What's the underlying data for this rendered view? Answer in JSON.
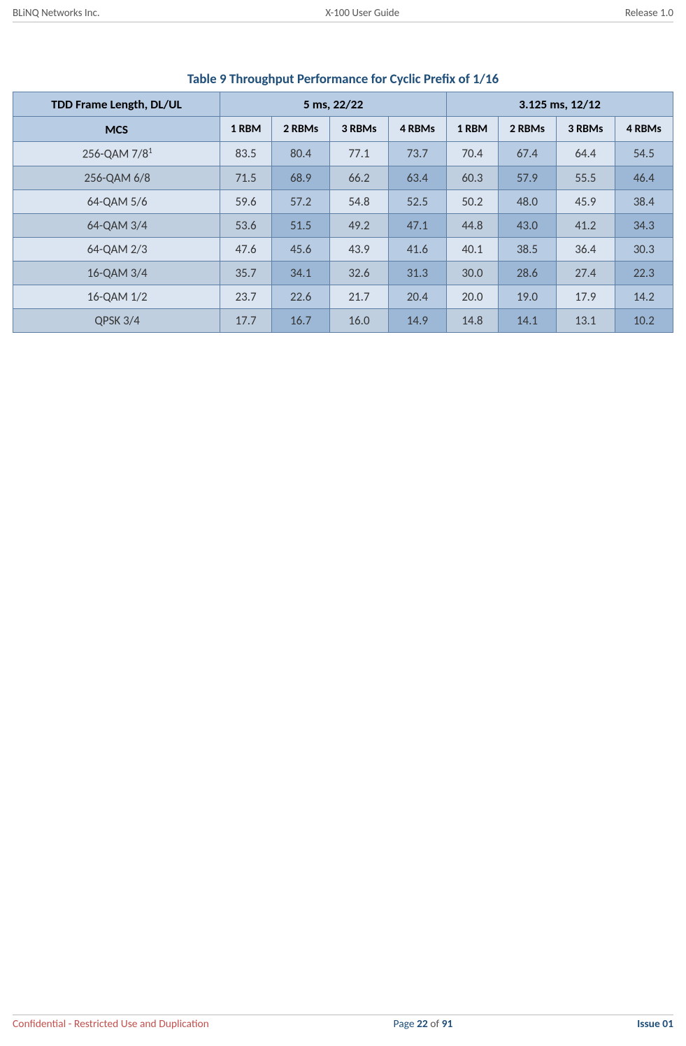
{
  "header": {
    "left": "BLiNQ Networks Inc.",
    "center": "X-100 User Guide",
    "right": "Release 1.0"
  },
  "table_title": "Table 9  Throughput Performance for Cyclic Prefix of 1/16",
  "columns": {
    "frame_label": "TDD Frame Length, DL/UL",
    "group1": "5 ms, 22/22",
    "group2": "3.125 ms, 12/12",
    "mcs": "MCS",
    "c1": "1 RBM",
    "c2": "2 RBMs",
    "c3": "3 RBMs",
    "c4": "4 RBMs",
    "c5": "1 RBM",
    "c6": "2 RBMs",
    "c7": "3 RBMs",
    "c8": "4 RBMs"
  },
  "rows": [
    {
      "label": "256-QAM 7/8",
      "sup": "1",
      "v": [
        "83.5",
        "80.4",
        "77.1",
        "73.7",
        "70.4",
        "67.4",
        "64.4",
        "54.5"
      ]
    },
    {
      "label": "256-QAM 6/8",
      "v": [
        "71.5",
        "68.9",
        "66.2",
        "63.4",
        "60.3",
        "57.9",
        "55.5",
        "46.4"
      ]
    },
    {
      "label": "64-QAM 5/6",
      "v": [
        "59.6",
        "57.2",
        "54.8",
        "52.5",
        "50.2",
        "48.0",
        "45.9",
        "38.4"
      ]
    },
    {
      "label": "64-QAM 3/4",
      "v": [
        "53.6",
        "51.5",
        "49.2",
        "47.1",
        "44.8",
        "43.0",
        "41.2",
        "34.3"
      ]
    },
    {
      "label": "64-QAM 2/3",
      "v": [
        "47.6",
        "45.6",
        "43.9",
        "41.6",
        "40.1",
        "38.5",
        "36.4",
        "30.3"
      ]
    },
    {
      "label": "16-QAM 3/4",
      "v": [
        "35.7",
        "34.1",
        "32.6",
        "31.3",
        "30.0",
        "28.6",
        "27.4",
        "22.3"
      ]
    },
    {
      "label": "16-QAM 1/2",
      "v": [
        "23.7",
        "22.6",
        "21.7",
        "20.4",
        "20.0",
        "19.0",
        "17.9",
        "14.2"
      ]
    },
    {
      "label": "QPSK 3/4",
      "v": [
        "17.7",
        "16.7",
        "16.0",
        "14.9",
        "14.8",
        "14.1",
        "13.1",
        "10.2"
      ]
    }
  ],
  "footer": {
    "left": "Confidential - Restricted Use and Duplication",
    "page_prefix": "Page ",
    "page_num": "22",
    "page_of": " of ",
    "page_total": "91",
    "right": "Issue 01"
  }
}
